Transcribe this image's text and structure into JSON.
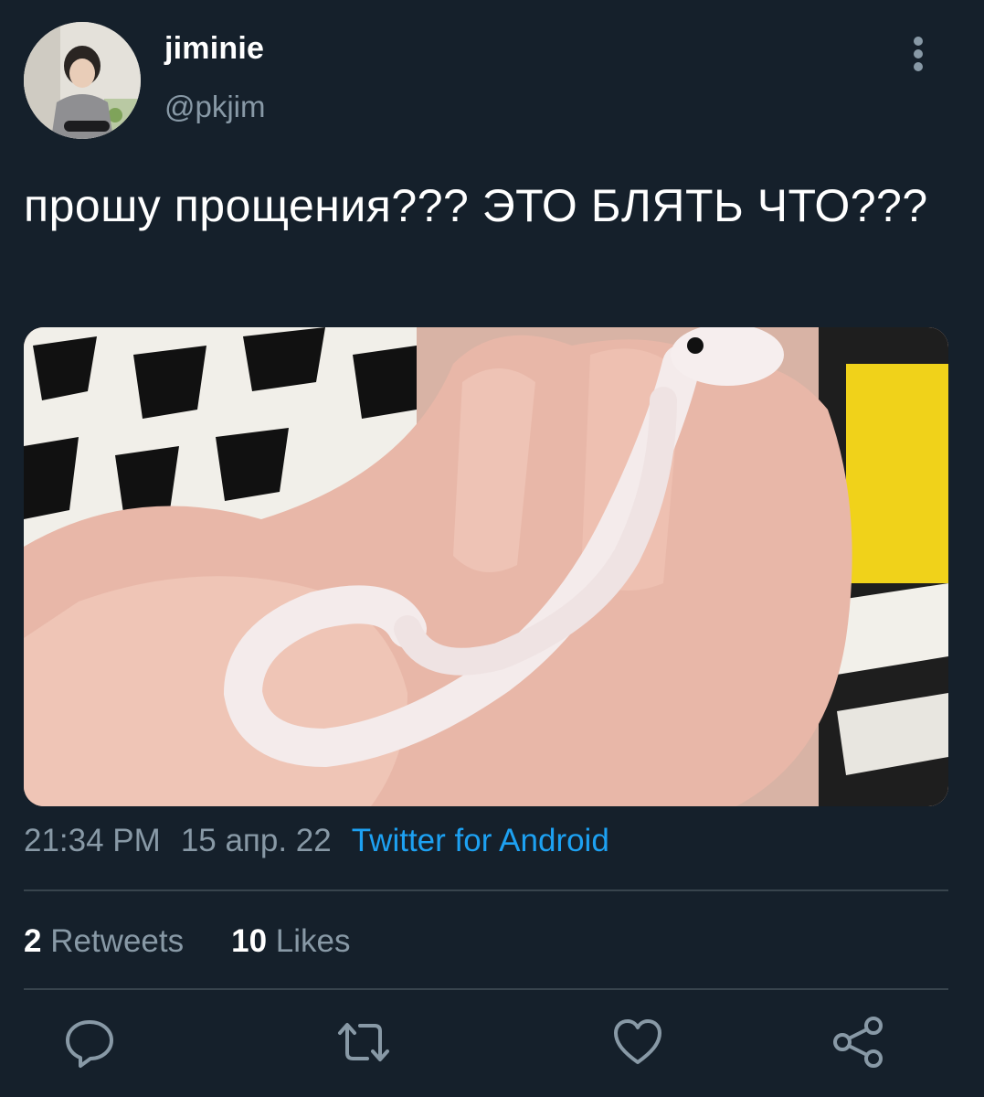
{
  "user": {
    "display_name": "jiminie",
    "handle": "@pkjim"
  },
  "tweet": {
    "text": "прошу прощения??? ЭТО БЛЯТЬ ЧТО???",
    "time": "21:34 PM",
    "date": "15 апр. 22",
    "source": "Twitter for Android"
  },
  "stats": {
    "retweets_count": "2",
    "retweets_label": "Retweets",
    "likes_count": "10",
    "likes_label": "Likes"
  },
  "actions": [
    "reply-icon",
    "retweet-icon",
    "like-icon",
    "share-icon"
  ],
  "colors": {
    "background": "#15202b",
    "secondary_text": "#8899a6",
    "link": "#1da1f2",
    "divider": "#38444d"
  }
}
